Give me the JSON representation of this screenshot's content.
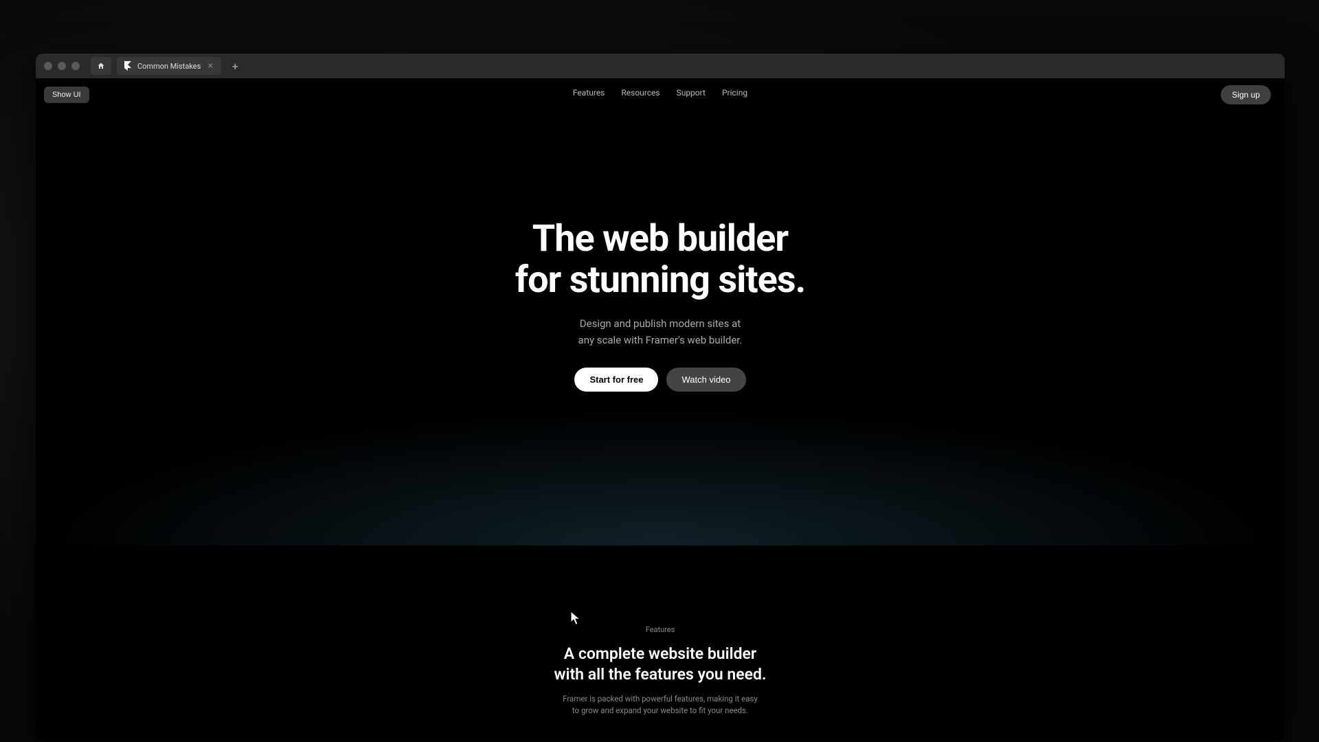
{
  "window": {
    "tab_title": "Common Mistakes",
    "show_ui_label": "Show UI"
  },
  "nav": {
    "links": [
      "Features",
      "Resources",
      "Support",
      "Pricing"
    ],
    "signup_label": "Sign up"
  },
  "hero": {
    "headline_line1": "The web builder",
    "headline_line2": "for stunning sites.",
    "sub_line1": "Design and publish modern sites at",
    "sub_line2": "any scale with Framer's web builder.",
    "cta_primary": "Start for free",
    "cta_secondary": "Watch video"
  },
  "features": {
    "label": "Features",
    "headline_line1": "A complete website builder",
    "headline_line2": "with all the features you need.",
    "sub_line1": "Framer is packed with powerful features, making it easy",
    "sub_line2": "to grow and expand your website to fit your needs."
  }
}
